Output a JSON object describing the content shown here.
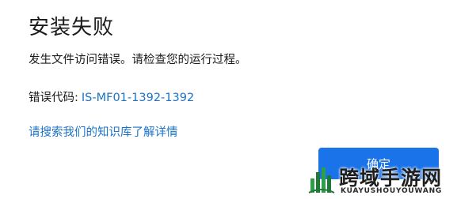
{
  "dialog": {
    "title": "安装失败",
    "message": "发生文件访问错误。请检查您的运行过程。",
    "error_label": "错误代码:",
    "error_code": "IS-MF01-1392-1392",
    "kb_link": "请搜索我们的知识库了解详情",
    "ok_button": "确定"
  },
  "watermark": {
    "name": "跨域手游网",
    "domain": "KUAYUSHOUYOUWANG"
  },
  "colors": {
    "link": "#1a73c8",
    "button": "#1a73e8",
    "background": "#ffffff"
  },
  "icons": [
    "watermark-logo-icon"
  ]
}
